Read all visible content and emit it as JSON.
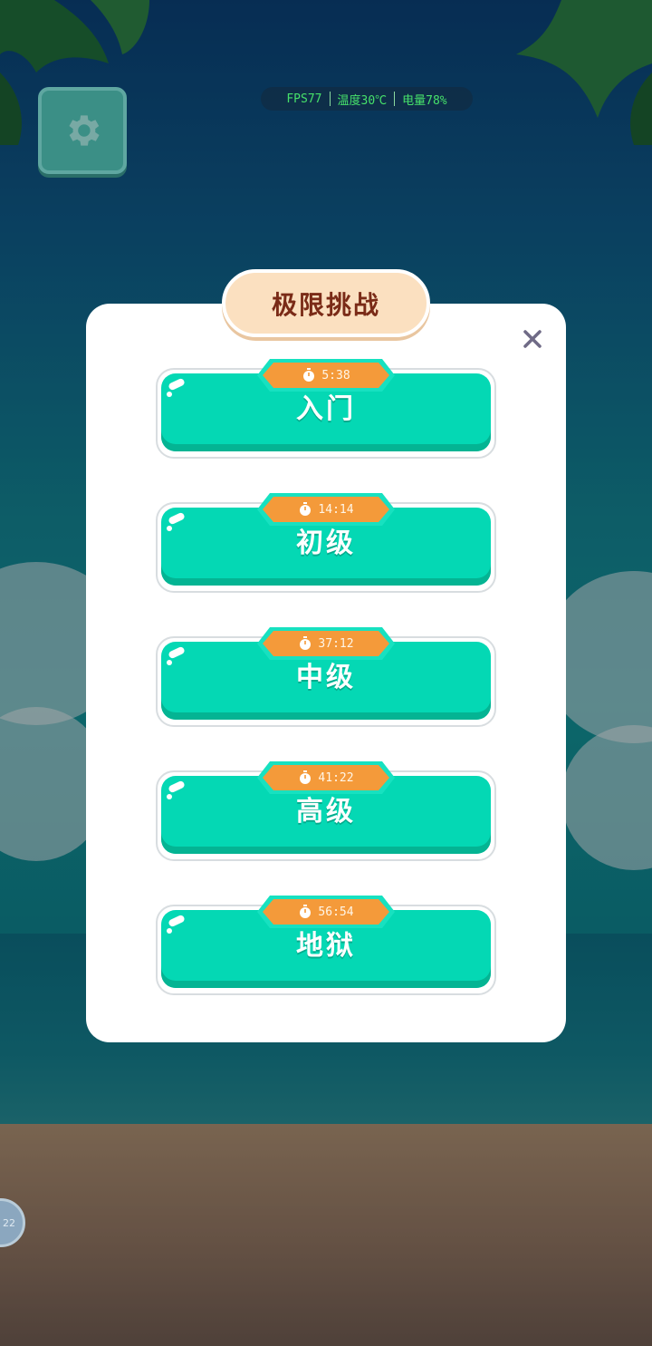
{
  "hud": {
    "fps": "FPS77",
    "temperature": "温度30℃",
    "battery": "电量78%"
  },
  "dialog": {
    "title": "极限挑战",
    "levels": [
      {
        "label": "入门",
        "time": "5:38"
      },
      {
        "label": "初级",
        "time": "14:14"
      },
      {
        "label": "中级",
        "time": "37:12"
      },
      {
        "label": "高级",
        "time": "41:22"
      },
      {
        "label": "地狱",
        "time": "56:54"
      }
    ]
  },
  "side_bubble": {
    "text": "22"
  },
  "icons": {
    "settings": "gear-icon",
    "close": "close-icon",
    "timer": "stopwatch-icon"
  },
  "colors": {
    "level_button": "#04d8b4",
    "timer_badge": "#f49a3a",
    "title_badge": "#fbe0c0",
    "title_text": "#7a2b17",
    "hud_text": "#46e06a"
  }
}
